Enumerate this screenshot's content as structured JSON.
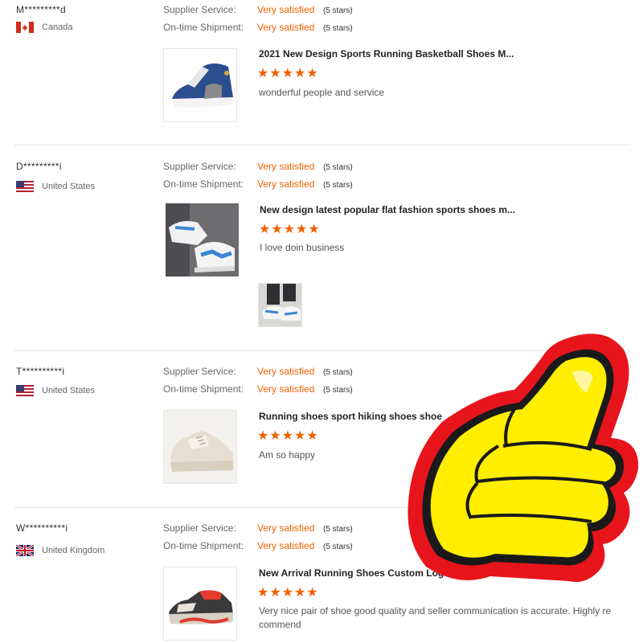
{
  "reviews": [
    {
      "buyer": "M*********d",
      "country": "Canada",
      "flag_icon": "canada-flag-icon",
      "supplier_label": "Supplier Service:",
      "supplier_value": "Very satisfied",
      "supplier_stars": "(5 stars)",
      "shipment_label": "On-time Shipment:",
      "shipment_value": "Very satisfied",
      "shipment_stars": "(5 stars)",
      "product_title": "2021 New Design Sports Running Basketball Shoes M...",
      "stars": "★★★★★",
      "comment": "wonderful people and service"
    },
    {
      "buyer": "D*********i",
      "country": "United States",
      "flag_icon": "us-flag-icon",
      "supplier_label": "Supplier Service:",
      "supplier_value": "Very satisfied",
      "supplier_stars": "(5 stars)",
      "shipment_label": "On-time Shipment:",
      "shipment_value": "Very satisfied",
      "shipment_stars": "(5 stars)",
      "product_title": "New design latest popular flat fashion sports shoes m...",
      "stars": "★★★★★",
      "comment": "I love doin business"
    },
    {
      "buyer": "T**********i",
      "country": "United States",
      "flag_icon": "us-flag-icon",
      "supplier_label": "Supplier Service:",
      "supplier_value": "Very satisfied",
      "supplier_stars": "(5 stars)",
      "shipment_label": "On-time Shipment:",
      "shipment_value": "Very satisfied",
      "shipment_stars": "(5 stars)",
      "product_title": "Running shoes sport hiking shoes shoe",
      "stars": "★★★★★",
      "comment": "Am so happy"
    },
    {
      "buyer": "W**********i",
      "country": "United Kingdom",
      "flag_icon": "uk-flag-icon",
      "supplier_label": "Supplier Service:",
      "supplier_value": "Very satisfied",
      "supplier_stars": "(5 stars)",
      "shipment_label": "On-time Shipment:",
      "shipment_value": "Very satisfied",
      "shipment_stars": "(5 stars)",
      "product_title": "New Arrival Running Shoes Custom Logo",
      "stars": "★★★★★",
      "comment": "Very nice pair of shoe good quality and seller communication is accurate. Highly re commend"
    }
  ],
  "colors": {
    "accent": "#f06000",
    "sticker_red": "#e8141c",
    "sticker_yellow": "#ffee00"
  },
  "overlay": {
    "icon": "thumbs-up-icon"
  }
}
